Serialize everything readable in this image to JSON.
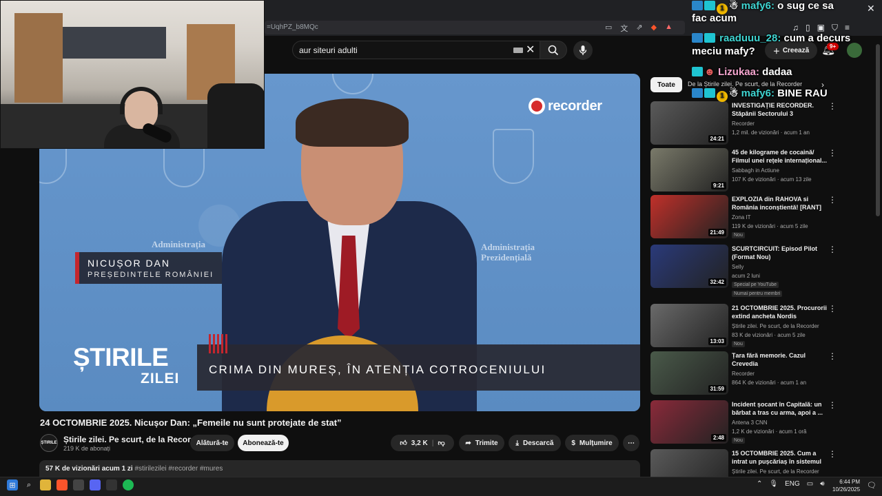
{
  "browser": {
    "address": "=UqhPZ_b8MQc",
    "close_glyph": "✕"
  },
  "header": {
    "search_value": "aur siteuri adulti",
    "create_label": "Creează",
    "notif_count": "9+"
  },
  "player": {
    "watermark": "recorder",
    "watermark_color": "#d62b2b",
    "admin_text": [
      "Administrația",
      "Administrația Prezidențială",
      "Administrația"
    ],
    "lower_third_name": "NICUȘOR DAN",
    "lower_third_role": "PREȘEDINTELE ROMÂNIEI",
    "brand_line1": "ȘTIRILE",
    "brand_line2": "ZILEI",
    "ticker": "CRIMA DIN MUREȘ, ÎN ATENȚIA COTROCENIULUI"
  },
  "video": {
    "title": "24 OCTOMBRIE 2025. Nicușor Dan: „Femeile nu sunt protejate de stat”",
    "channel_avatar": "ȘTIRILE",
    "channel_name": "Știrile zilei. Pe scurt, de la Recorder",
    "subscribers": "219 K de abonați",
    "join_label": "Alătură-te",
    "subscribe_label": "Abonează-te",
    "likes": "3,2 K",
    "share_label": "Trimite",
    "download_label": "Descarcă",
    "thanks_label": "Mulțumire",
    "views_date": "57 K de vizionări  acum 1 zi",
    "tags": "#stirilezilei #recorder #mures"
  },
  "sidebar": {
    "filter_all": "Toate",
    "filter_next": "›",
    "items": [
      {
        "title": "INVESTIGAȚIE RECORDER. Stăpânii Sectorului 3",
        "channel": "Recorder",
        "meta": "1,2 mil. de vizionări · acum 1 an",
        "duration": "24:21",
        "badge": "",
        "thumb": "#5a5a5a"
      },
      {
        "title": "45 de kilograme de cocaină/ Filmul unei rețele internațional...",
        "channel": "Sabbagh in Actiune",
        "meta": "107 K de vizionări · acum 13 zile",
        "duration": "9:21",
        "badge": "",
        "thumb": "#7a7a6a"
      },
      {
        "title": "EXPLOZIA din RAHOVA si România inconștientă! [RANT]",
        "channel": "Zona IT",
        "meta": "119 K de vizionări · acum 5 zile",
        "duration": "21:49",
        "badge": "Nou",
        "thumb": "#c0302a"
      },
      {
        "title": "SCURTCIRCUIT: Episod Pilot (Format Nou)",
        "channel": "Selly",
        "meta": "acum 2 luni",
        "duration": "32:42",
        "badge": "Special pe YouTube",
        "thumb": "#2a3a7a"
      },
      {
        "title": "21 OCTOMBRIE 2025. Procurorii extind ancheta Nordis",
        "channel": "Știrile zilei. Pe scurt, de la Recorder",
        "meta": "83 K de vizionări · acum 5 zile",
        "duration": "13:03",
        "badge": "Nou",
        "thumb": "#6a6a6a"
      },
      {
        "title": "Țara fără memorie. Cazul Crevedia",
        "channel": "Recorder",
        "meta": "864 K de vizionări · acum 1 an",
        "duration": "31:59",
        "badge": "",
        "thumb": "#4a5a4a"
      },
      {
        "title": "Incident șocant în Capitală: un bărbat a tras cu arma, apoi a ...",
        "channel": "Antena 3 CNN",
        "meta": "1,2 K de vizionări · acum 1 oră",
        "duration": "2:48",
        "badge": "Nou",
        "thumb": "#8a2a3a"
      },
      {
        "title": "15 OCTOMBRIE 2025. Cum a intrat un pușcăriaș în sistemul ...",
        "channel": "Știrile zilei. Pe scurt, de la Recorder",
        "meta": "",
        "duration": "",
        "badge": "",
        "thumb": "#5a5a5a"
      }
    ],
    "members_only": "Numai pentru membri"
  },
  "chat": [
    {
      "user": "mafy6:",
      "msg": "o sug ce sa",
      "msg2": "fac acum"
    },
    {
      "user": "raaduuu_28:",
      "msg": "cum a decurs",
      "msg2": "meciu mafy?"
    },
    {
      "user": "Lizukaa:",
      "msg": "dadaa"
    },
    {
      "user": "mafy6:",
      "msg": "BINE RAU"
    }
  ],
  "chat_sub_label": "De la Știrile zilei. Pe scurt, de la Recorder",
  "taskbar": {
    "lang": "ENG",
    "time": "6:44 PM",
    "date": "10/26/2025"
  }
}
